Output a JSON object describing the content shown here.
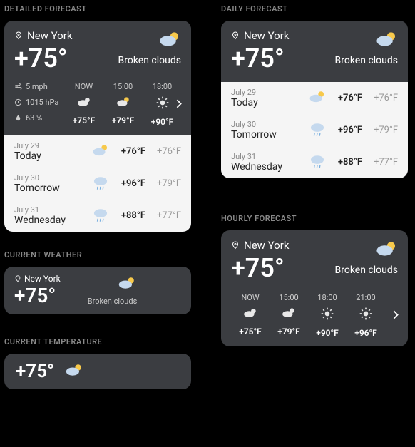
{
  "sections": {
    "detailed": "DETAILED FORECAST",
    "daily": "DAILY FORECAST",
    "current": "CURRENT WEATHER",
    "temp": "CURRENT TEMPERATURE",
    "hourly": "HOURLY FORECAST"
  },
  "location": "New York",
  "current_temp": "+75°",
  "condition": "Broken clouds",
  "stats": {
    "wind": "5 mph",
    "pressure": "1015 hPa",
    "humidity": "63 %"
  },
  "hourly_detailed": [
    {
      "label": "NOW",
      "temp": "+75°F",
      "icon": "cloud-moon"
    },
    {
      "label": "15:00",
      "temp": "+79°F",
      "icon": "cloud-sun"
    },
    {
      "label": "18:00",
      "temp": "+90°F",
      "icon": "sun"
    }
  ],
  "hourly_full": [
    {
      "label": "NOW",
      "temp": "+75°F",
      "icon": "cloud-moon"
    },
    {
      "label": "15:00",
      "temp": "+79°F",
      "icon": "cloud-sun"
    },
    {
      "label": "18:00",
      "temp": "+90°F",
      "icon": "sun"
    },
    {
      "label": "21:00",
      "temp": "+96°F",
      "icon": "sun"
    }
  ],
  "daily_items": [
    {
      "date": "July 29",
      "day": "Today",
      "hi": "+76°F",
      "lo": "+76°F",
      "icon": "cloud-sun-sm"
    },
    {
      "date": "July 30",
      "day": "Tomorrow",
      "hi": "+96°F",
      "lo": "+79°F",
      "icon": "rain"
    },
    {
      "date": "July 31",
      "day": "Wednesday",
      "hi": "+88°F",
      "lo": "+77°F",
      "icon": "rain"
    }
  ]
}
